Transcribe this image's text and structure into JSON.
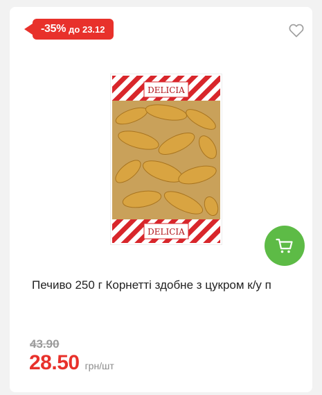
{
  "badge": {
    "percent": "-35%",
    "until": "до 23.12",
    "color": "#e8312b"
  },
  "favorite": {
    "icon": "heart-outline-icon"
  },
  "image": {
    "brand_top": "DELICIA",
    "brand_bottom": "DELICIA"
  },
  "cart": {
    "icon": "cart-icon",
    "color": "#5dbb46"
  },
  "product": {
    "name": "Печиво 250 г Корнетті здобне з цукром к/у п"
  },
  "price": {
    "old": "43.90",
    "current": "28.50",
    "unit": "грн/шт"
  }
}
